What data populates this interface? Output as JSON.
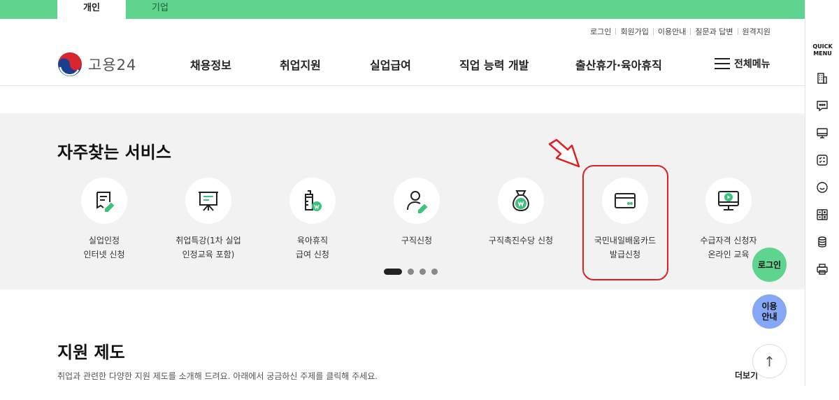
{
  "top_tabs": [
    {
      "label": "개인",
      "active": true
    },
    {
      "label": "기업",
      "active": false
    }
  ],
  "utility_links": [
    "로그인",
    "회원가입",
    "이용안내",
    "질문과 답변",
    "원격지원"
  ],
  "logo": {
    "text": "고용24"
  },
  "nav": [
    "채용정보",
    "취업지원",
    "실업급여",
    "직업 능력 개발",
    "출산휴가·육아휴직"
  ],
  "all_menu": "전체메뉴",
  "services": {
    "title": "자주찾는 서비스",
    "items": [
      {
        "line1": "실업인정",
        "line2": "인터넷 신청",
        "icon": "document-pen-icon"
      },
      {
        "line1": "취업특강(1차 실업",
        "line2": "인정교육 포함)",
        "icon": "presentation-board-icon"
      },
      {
        "line1": "육아휴직",
        "line2": "급여 신청",
        "icon": "baby-bottle-icon"
      },
      {
        "line1": "구직신청",
        "line2": "",
        "icon": "person-pen-icon"
      },
      {
        "line1": "구직촉진수당 신청",
        "line2": "",
        "icon": "money-bag-icon"
      },
      {
        "line1": "국민내일배움카드",
        "line2": "발급신청",
        "icon": "card-icon"
      },
      {
        "line1": "수급자격 신청자",
        "line2": "온라인 교육",
        "icon": "monitor-play-icon"
      }
    ],
    "pagination_count": 4,
    "active_page": 1
  },
  "support": {
    "title": "지원 제도",
    "description": "취업과 관련한 다양한 지원 제도를 소개해 드려요. 아래에서 궁금하신 주제를 클릭해 주세요.",
    "more": "더보기"
  },
  "floating": {
    "login": "로그인",
    "guide_line1": "이용",
    "guide_line2": "안내",
    "top": "↑"
  },
  "quick_menu": {
    "title_line1": "QUICK",
    "title_line2": "MENU",
    "icons": [
      "building-icon",
      "chat-icon",
      "monitor-icon",
      "checklist-icon",
      "smile-icon",
      "calculator-icon",
      "coins-icon",
      "printer-icon"
    ]
  },
  "colors": {
    "brand_green": "#5fd48f",
    "accent_green": "#3cc27a",
    "guide_blue": "#86a7f5",
    "highlight_red": "#e01f1f"
  }
}
